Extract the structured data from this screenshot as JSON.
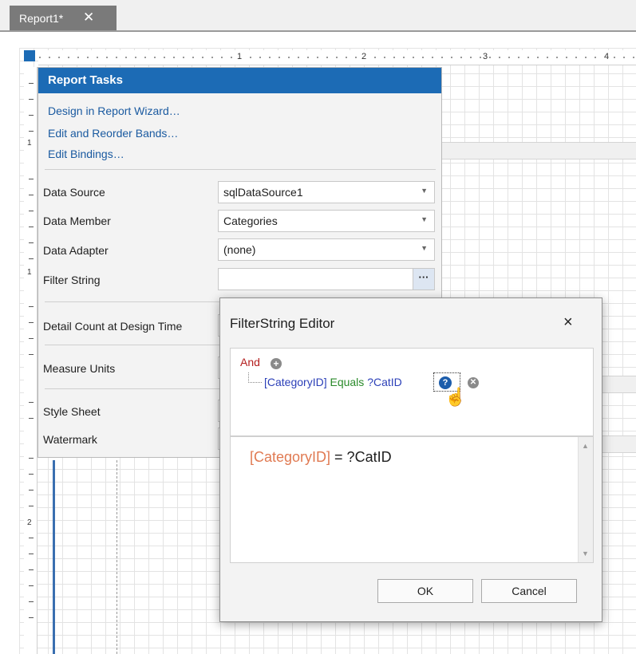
{
  "tabs": [
    {
      "label": "Report1*",
      "close": "✕"
    }
  ],
  "ruler": {
    "h_labels": [
      "1",
      "2",
      "3",
      "4"
    ],
    "v_labels": [
      "1",
      "1",
      "2"
    ]
  },
  "report_tasks": {
    "title": "Report Tasks",
    "links": [
      "Design in Report Wizard…",
      "Edit and Reorder Bands…",
      "Edit Bindings…"
    ],
    "properties": [
      {
        "label": "Data Source",
        "value": "sqlDataSource1"
      },
      {
        "label": "Data Member",
        "value": "Categories"
      },
      {
        "label": "Data Adapter",
        "value": "(none)"
      },
      {
        "label": "Filter String",
        "value": ""
      },
      {
        "label": "Detail Count at Design Time",
        "value": ""
      },
      {
        "label": "Measure Units",
        "value": ""
      },
      {
        "label": "Style Sheet",
        "value": ""
      },
      {
        "label": "Watermark",
        "value": ""
      }
    ],
    "ellipsis": "···"
  },
  "filter_editor": {
    "title": "FilterString Editor",
    "close": "×",
    "group_operator": "And",
    "condition": {
      "field": "[CategoryID]",
      "operator": "Equals",
      "value": "?CatID"
    },
    "expression": {
      "field": "[CategoryID]",
      "rest": " = ?CatID"
    },
    "ok_label": "OK",
    "cancel_label": "Cancel"
  },
  "colors": {
    "accent": "#1c6bb5",
    "group_operator": "#b41e1e",
    "field": "#2b3fb8",
    "operator": "#2a8a2a",
    "expr_field": "#e07a52"
  }
}
